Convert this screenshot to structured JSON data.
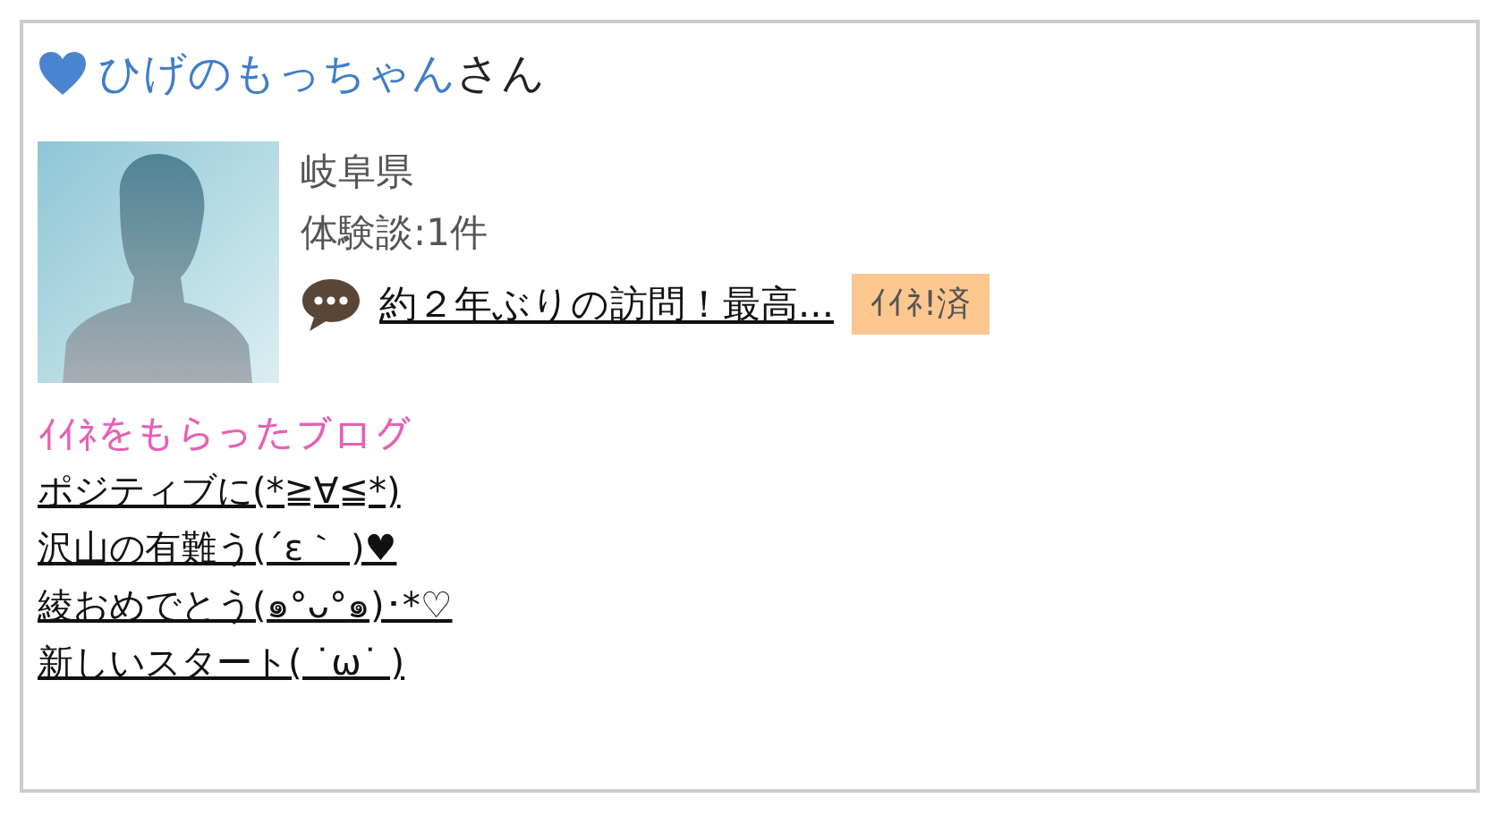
{
  "user": {
    "name": "ひげのもっちゃん",
    "suffix": "さん"
  },
  "profile": {
    "prefecture": "岐阜県",
    "reviews": "体験談:1件",
    "latest_post": "約２年ぶりの訪問！最高...",
    "like_badge": "ｲｲﾈ!済"
  },
  "liked_blogs": {
    "title": "ｲｲﾈをもらったブログ",
    "items": [
      "ポジティブに(*≧∀≦*)",
      "沢山の有難う(´ε｀ )♥",
      "綾おめでとう(๑°ᴗ°๑)･*♡",
      "新しいスタート( ˙ω˙ )"
    ]
  }
}
